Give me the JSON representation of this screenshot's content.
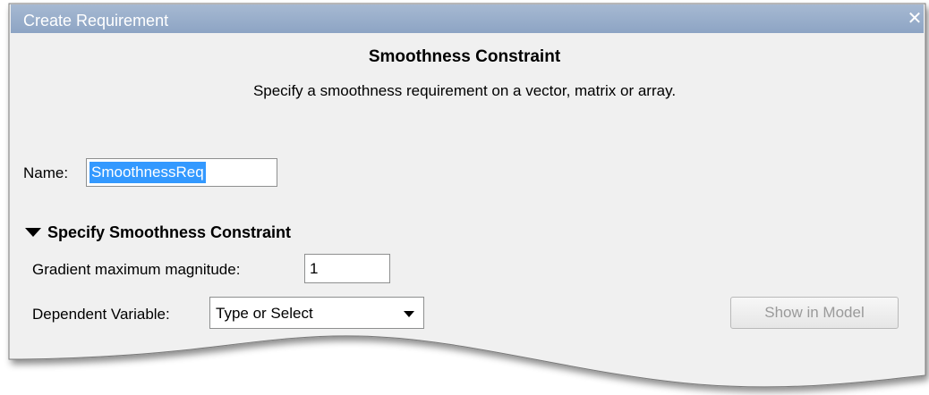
{
  "window": {
    "title": "Create Requirement",
    "close_icon": "close-icon"
  },
  "header": {
    "title": "Smoothness Constraint",
    "description": "Specify a smoothness requirement on a vector, matrix or array."
  },
  "name_field": {
    "label": "Name:",
    "value": "SmoothnessReq"
  },
  "section": {
    "label": "Specify Smoothness Constraint",
    "expanded": true,
    "gradient": {
      "label": "Gradient maximum magnitude:",
      "value": "1"
    },
    "dependent": {
      "label": "Dependent Variable:",
      "value": "Type or Select"
    }
  },
  "show_button": {
    "label": "Show in Model",
    "enabled": false
  },
  "colors": {
    "titlebar": "#97abc9",
    "selection": "#3399ff",
    "panel": "#f0f0f0"
  }
}
